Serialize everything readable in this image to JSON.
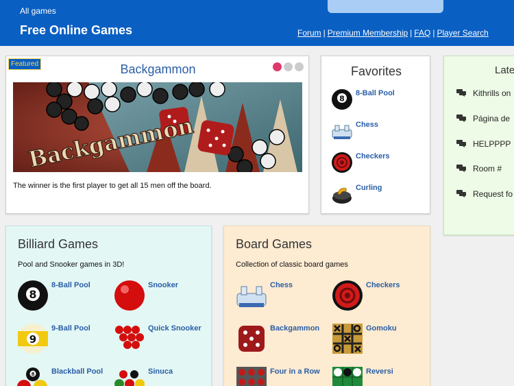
{
  "header": {
    "breadcrumb": "All games",
    "title": "Free Online Games",
    "nav": [
      "Forum",
      "Premium Membership",
      "FAQ",
      "Player Search"
    ],
    "nav_separator": "|"
  },
  "featured": {
    "badge": "Featured",
    "title": "Backgammon",
    "image_text": "Backgammon",
    "description": "The winner is the first player to get all 15 men off the board.",
    "slides_total": 3,
    "slide_active": 1
  },
  "favorites": {
    "title": "Favorites",
    "items": [
      {
        "label": "8-Ball Pool",
        "icon": "eight-ball-icon"
      },
      {
        "label": "Chess",
        "icon": "chess-icon"
      },
      {
        "label": "Checkers",
        "icon": "checkers-icon"
      },
      {
        "label": "Curling",
        "icon": "curling-stone-icon"
      }
    ]
  },
  "latest": {
    "title": "Late",
    "posts": [
      "Kithrills on",
      "Página de",
      "HELPPPP",
      "Room #",
      "Request fo"
    ]
  },
  "billiard": {
    "title": "Billiard Games",
    "description": "Pool and Snooker games in 3D!",
    "games": [
      "8-Ball Pool",
      "Snooker",
      "9-Ball Pool",
      "Quick Snooker",
      "Blackball Pool",
      "Sinuca"
    ]
  },
  "board": {
    "title": "Board Games",
    "description": "Collection of classic board games",
    "games": [
      "Chess",
      "Checkers",
      "Backgammon",
      "Gomoku",
      "Four in a Row",
      "Reversi"
    ]
  },
  "colors": {
    "header": "#0a5fc2",
    "link": "#2a5ea6",
    "billiard_bg": "#e3f7f5",
    "board_bg": "#fdebd2",
    "latest_bg": "#eefbe7",
    "dot_active": "#e0386a"
  }
}
